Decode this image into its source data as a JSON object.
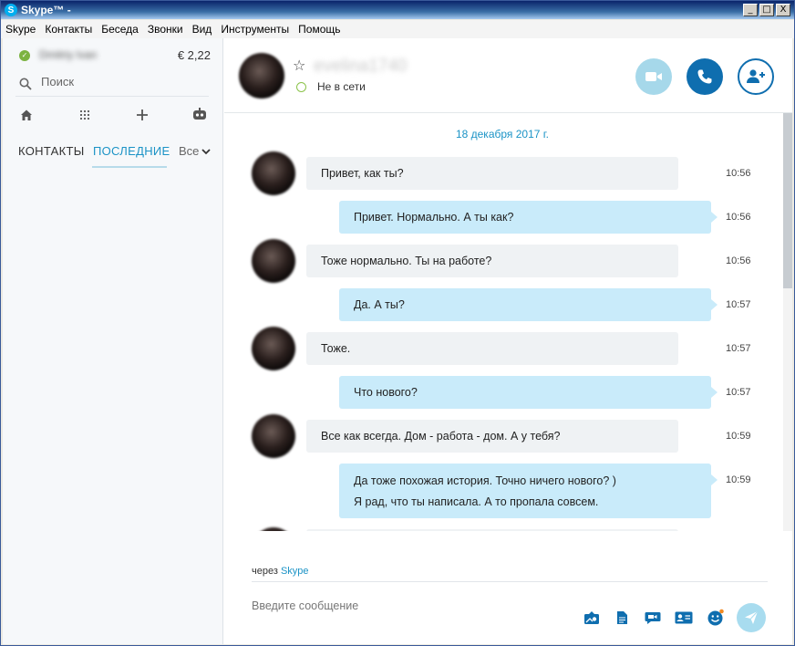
{
  "window": {
    "title": "Skype™ -",
    "controls": [
      "_",
      "□",
      "X"
    ]
  },
  "menu": [
    "Skype",
    "Контакты",
    "Беседа",
    "Звонки",
    "Вид",
    "Инструменты",
    "Помощь"
  ],
  "profile": {
    "name": "Dmitriy Ivan",
    "credit": "€ 2,22"
  },
  "search": {
    "placeholder": "Поиск"
  },
  "tabs": {
    "contacts": "КОНТАКТЫ",
    "recent": "ПОСЛЕДНИЕ",
    "filter": "Все"
  },
  "contact": {
    "name": "evelina1740",
    "status": "Не в сети"
  },
  "conversation": {
    "date": "18 декабря 2017 г.",
    "messages": [
      {
        "dir": "in",
        "text": "Привет, как ты?",
        "time": "10:56"
      },
      {
        "dir": "out",
        "text": "Привет. Нормально. А ты как?",
        "time": "10:56"
      },
      {
        "dir": "in",
        "text": "Тоже нормально. Ты на работе?",
        "time": "10:56"
      },
      {
        "dir": "out",
        "text": "Да. А ты?",
        "time": "10:57"
      },
      {
        "dir": "in",
        "text": "Тоже.",
        "time": "10:57"
      },
      {
        "dir": "out",
        "text": "Что нового?",
        "time": "10:57"
      },
      {
        "dir": "in",
        "text": "Все как всегда. Дом - работа - дом. А у тебя?",
        "time": "10:59"
      },
      {
        "dir": "out",
        "text": "Да тоже похожая история. Точно ничего нового? )",
        "text2": "Я рад, что ты написала. А то пропала совсем.",
        "time": "10:59"
      }
    ]
  },
  "composer": {
    "via_prefix": "через",
    "via_link": "Skype",
    "placeholder": "Введите сообщение"
  },
  "colors": {
    "accent": "#1b93c6",
    "outgoing_bubble": "#c9ebfa",
    "incoming_bubble": "#eff2f4",
    "call_button": "#0f6eaf",
    "video_button": "#a6d8ea"
  }
}
